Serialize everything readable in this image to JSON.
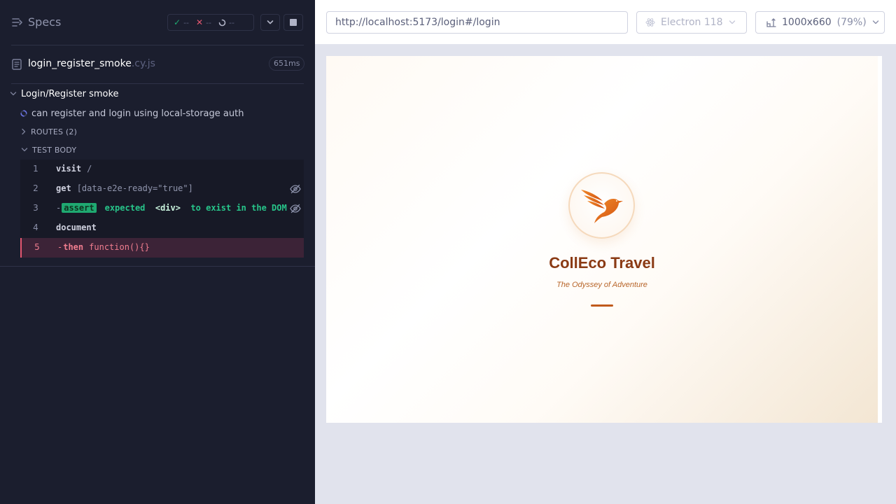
{
  "reporter": {
    "header": {
      "title": "Specs",
      "stats": {
        "passed": "--",
        "failed": "--",
        "pending": "--"
      }
    },
    "spec": {
      "file_name": "login_register_smoke",
      "file_ext": ".cy.js",
      "duration": "651ms"
    },
    "suite": {
      "title": "Login/Register smoke",
      "test": {
        "title": "can register and login using local-storage auth",
        "state": "running"
      },
      "routes_label": "ROUTES (2)",
      "body_label": "TEST BODY"
    },
    "commands": [
      {
        "number": "1",
        "name": "visit",
        "message": "/"
      },
      {
        "number": "2",
        "name": "get",
        "message": "[data-e2e-ready=\"true\"]"
      },
      {
        "number": "3",
        "dash": "-",
        "badge": "assert",
        "msg_pre": "expected",
        "msg_em": "<div>",
        "msg_post": "to exist in the DOM"
      },
      {
        "number": "4",
        "name": "document",
        "message": ""
      },
      {
        "number": "5",
        "dash": "-",
        "name": "then",
        "message": "function(){}",
        "state": "failed"
      }
    ]
  },
  "aut": {
    "url": "http://localhost:5173/login#/login",
    "browser": "Electron 118",
    "viewport": "1000x660",
    "scale": "(79%)",
    "page": {
      "app_name": "CollEco Travel",
      "tagline": "The Odyssey of Adventure"
    }
  },
  "colors": {
    "reporter_bg": "#1b1e2e",
    "pass": "#1fa971",
    "fail": "#e45770",
    "brand_orange": "#e8691c",
    "brand_brown": "#8a3a14"
  },
  "icons": [
    "specs-icon",
    "check-icon",
    "x-icon",
    "pending-icon",
    "chevron-down-icon",
    "stop-icon",
    "file-icon",
    "chevron-right-icon",
    "running-icon",
    "eye-slash-icon",
    "electron-icon",
    "viewport-icon",
    "bird-logo-icon"
  ]
}
